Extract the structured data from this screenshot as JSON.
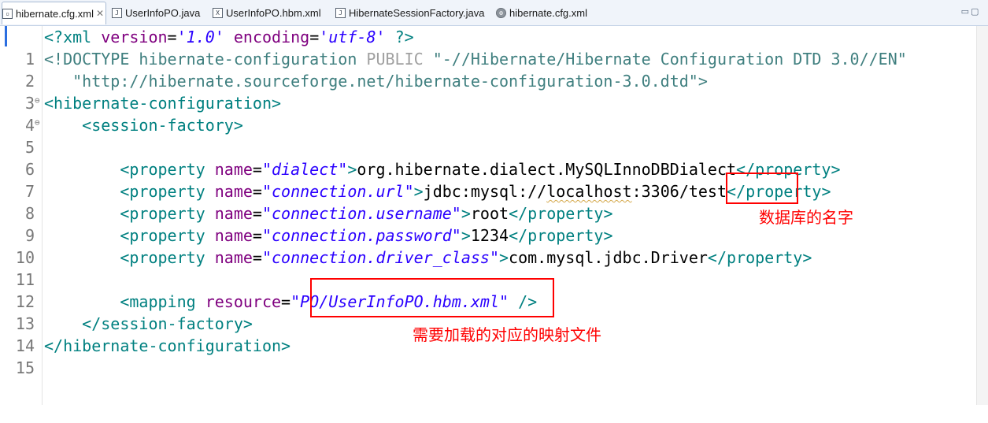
{
  "tabs": [
    {
      "label": "hibernate.cfg.xml",
      "icon": "xml-file-icon",
      "active": true,
      "close": "✕"
    },
    {
      "label": "UserInfoPO.java",
      "icon": "java-file-icon"
    },
    {
      "label": "UserInfoPO.hbm.xml",
      "icon": "hbm-file-icon"
    },
    {
      "label": "HibernateSessionFactory.java",
      "icon": "java-file-icon"
    },
    {
      "label": "hibernate.cfg.xml",
      "icon": "config-file-icon"
    }
  ],
  "window_buttons": "▭▢",
  "lines": [
    {
      "num": "1",
      "fold": ""
    },
    {
      "num": "2",
      "fold": ""
    },
    {
      "num": "3",
      "fold": ""
    },
    {
      "num": "4",
      "fold": "⊖"
    },
    {
      "num": "5",
      "fold": "⊖"
    },
    {
      "num": "6",
      "fold": ""
    },
    {
      "num": "7",
      "fold": ""
    },
    {
      "num": "8",
      "fold": ""
    },
    {
      "num": "9",
      "fold": ""
    },
    {
      "num": "10",
      "fold": ""
    },
    {
      "num": "11",
      "fold": ""
    },
    {
      "num": "12",
      "fold": ""
    },
    {
      "num": "13",
      "fold": ""
    },
    {
      "num": "14",
      "fold": ""
    },
    {
      "num": "15",
      "fold": ""
    }
  ],
  "code": {
    "decl_open": "<?xml ",
    "decl_version_attr": "version",
    "decl_version_val": "'1.0'",
    "decl_encoding_attr": "encoding",
    "decl_encoding_val": "'utf-8'",
    "decl_close": " ?>",
    "doctype_open": "<!DOCTYPE ",
    "doctype_root": "hibernate-configuration",
    "doctype_public": "PUBLIC",
    "doctype_public_id": "\"-//Hibernate/Hibernate Configuration DTD 3.0//EN\"",
    "doctype_system_id": "\"http://hibernate.sourceforge.net/hibernate-configuration-3.0.dtd\">",
    "cfg_open": "<hibernate-configuration>",
    "sf_open": "<session-factory>",
    "prop_open": "<property ",
    "name_attr": "name",
    "eq": "=",
    "gt": ">",
    "prop_close": "</property>",
    "p1_name": "\"dialect\"",
    "p1_value": "org.hibernate.dialect.MySQLInnoDBDialect",
    "p2_name": "\"connection.url\"",
    "p2_value_prefix": "jdbc:mysql://",
    "p2_value_host": "localhost",
    "p2_value_port": ":3306",
    "p2_value_db": "/test",
    "p3_name": "\"connection.username\"",
    "p3_value": "root",
    "p4_name": "\"connection.password\"",
    "p4_value": "1234",
    "p5_name": "\"connection.driver_class\"",
    "p5_value": "com.mysql.jdbc.Driver",
    "mapping_open": "<mapping ",
    "resource_attr": "resource",
    "resource_val": "\"PO/UserInfoPO.hbm.xml\"",
    "mapping_close": " />",
    "sf_close": "</session-factory>",
    "cfg_close": "</hibernate-configuration>"
  },
  "annotations": {
    "db_name": "数据库的名字",
    "mapping_file": "需要加载的对应的映射文件"
  },
  "colors": {
    "tag": "#008080",
    "attribute": "#7f007f",
    "attribute_value": "#2a00ff",
    "annotation": "#ff0000"
  }
}
